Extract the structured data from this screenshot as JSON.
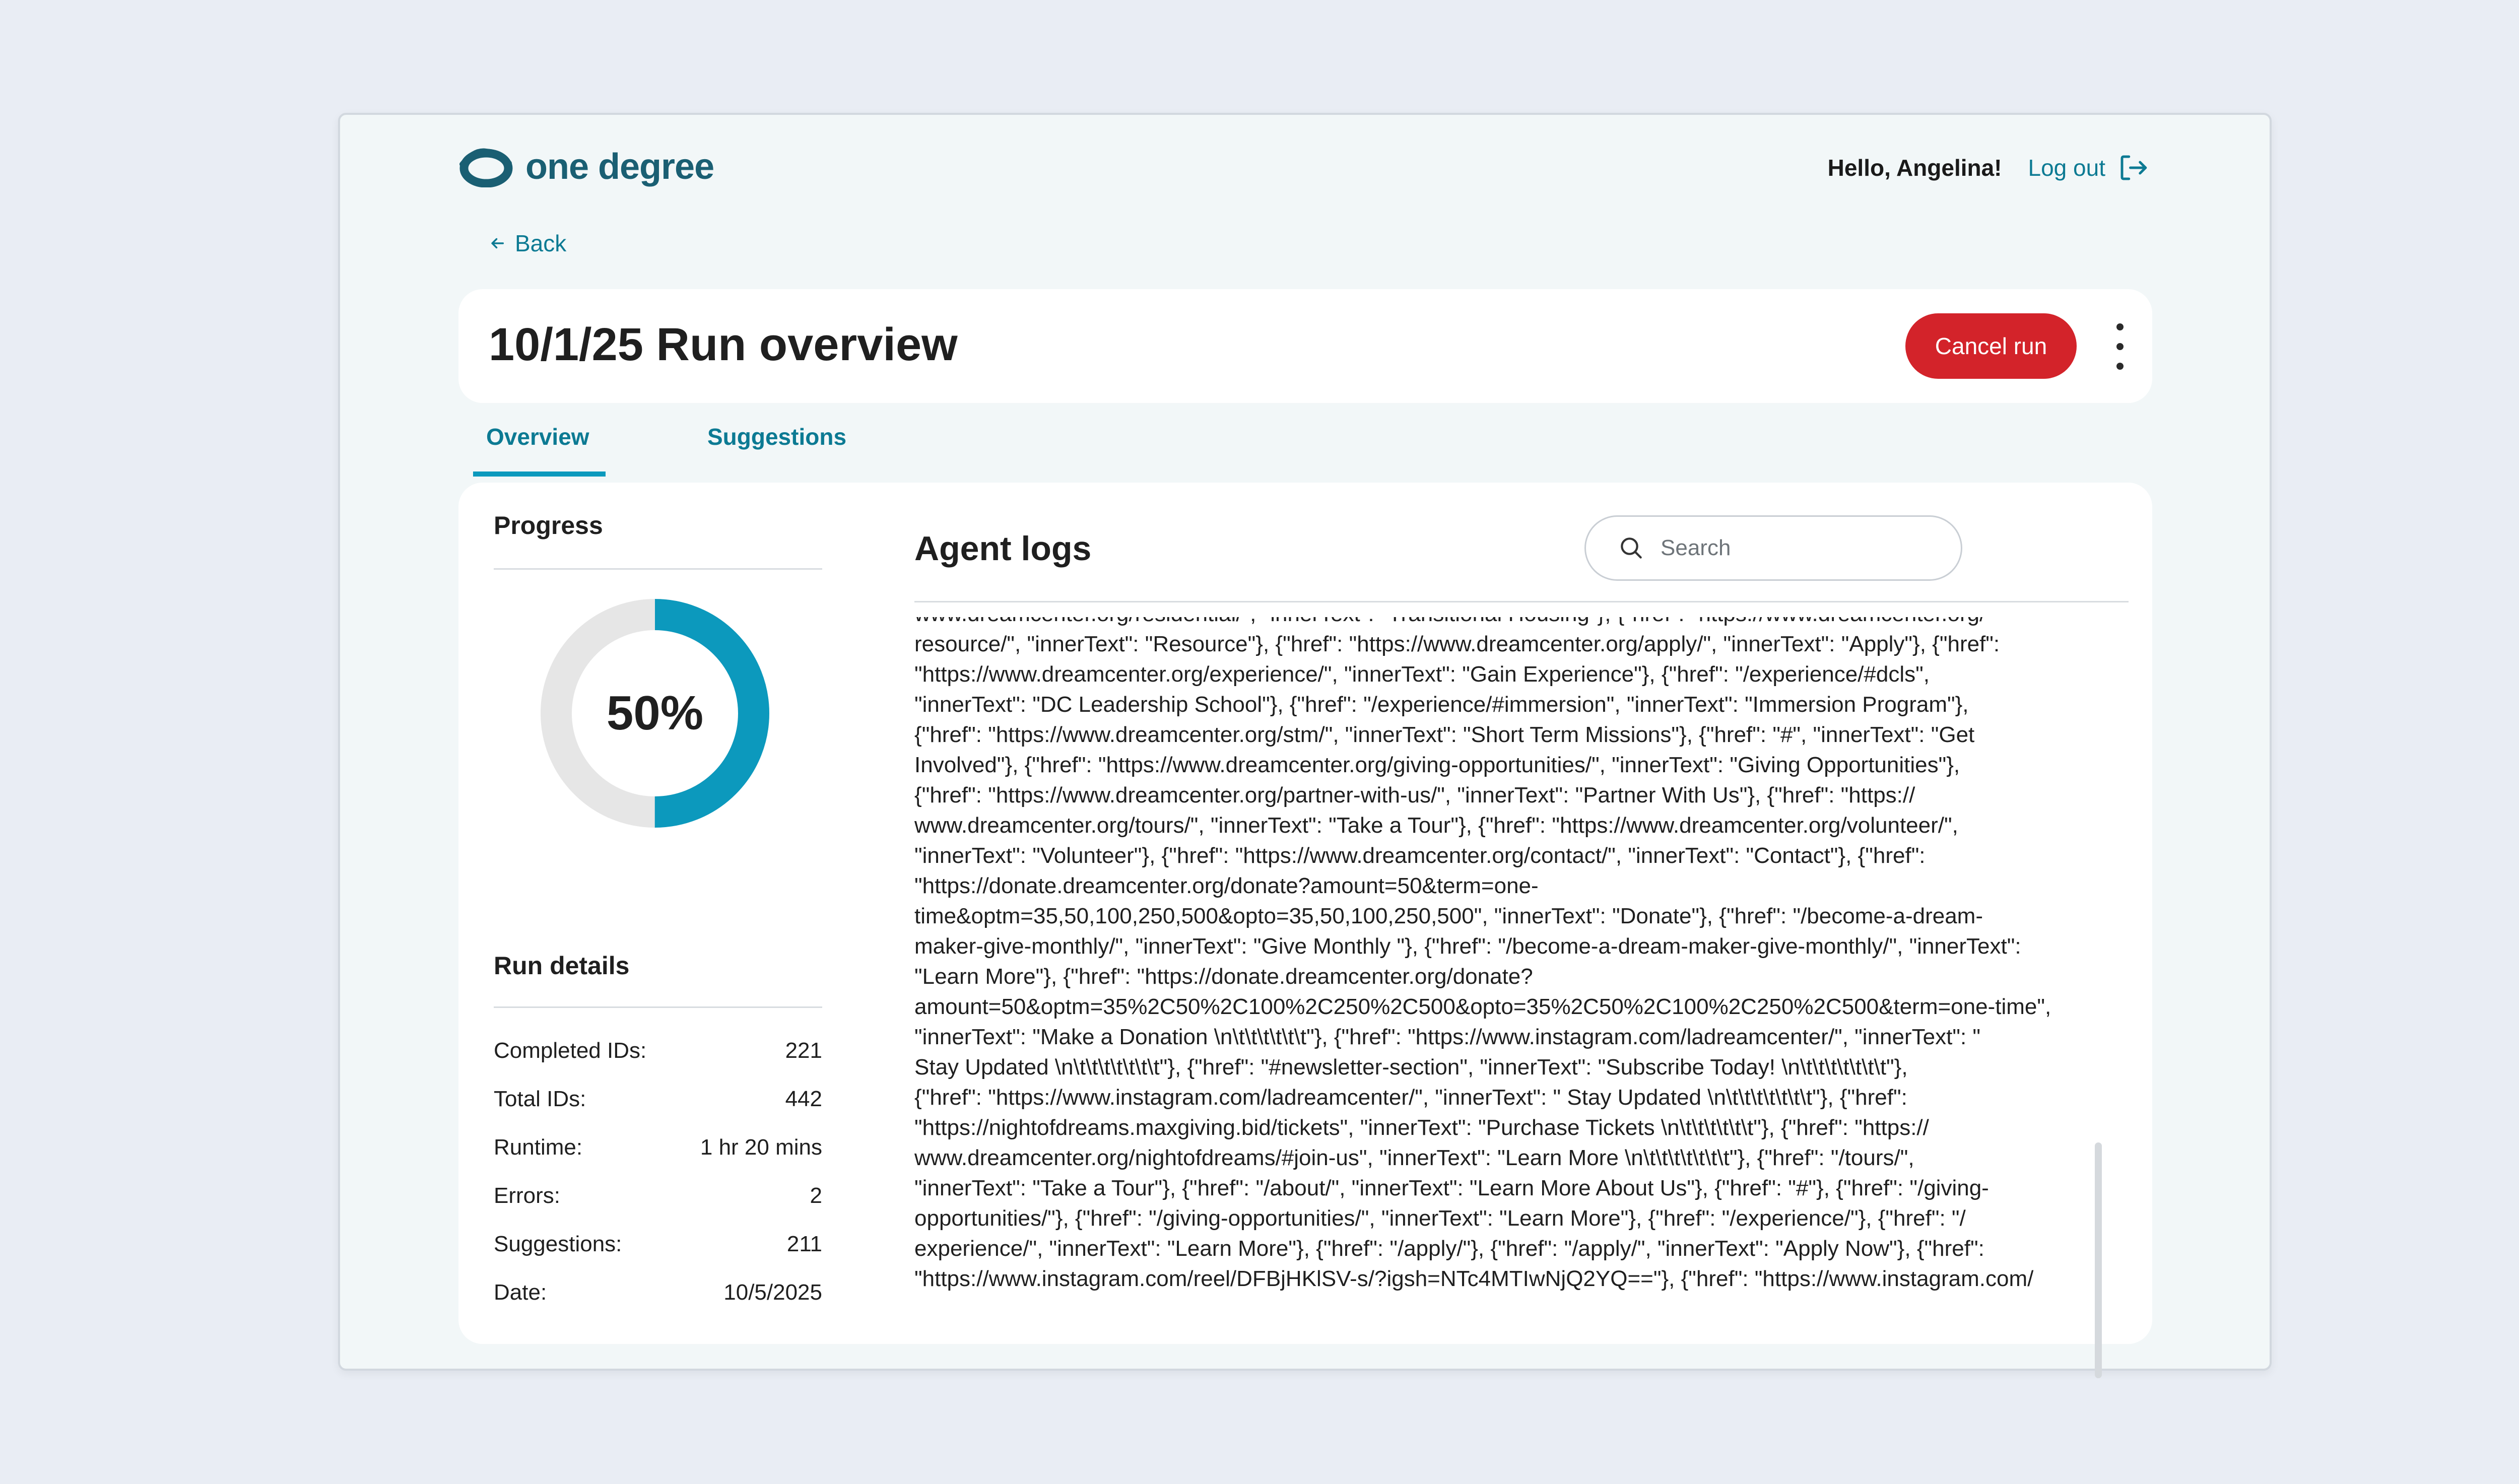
{
  "brand": {
    "name": "one degree",
    "logo_icon": "one-degree-logo-icon",
    "color": "#1a5f73"
  },
  "user": {
    "greeting": "Hello, Angelina!",
    "logout_label": "Log out"
  },
  "nav": {
    "back_label": "Back"
  },
  "header": {
    "title": "10/1/25 Run overview",
    "cancel_label": "Cancel run"
  },
  "tabs": [
    {
      "label": "Overview",
      "active": true
    },
    {
      "label": "Suggestions",
      "active": false
    }
  ],
  "progress": {
    "title": "Progress",
    "percent": 50,
    "percent_label": "50%",
    "track_color": "#e6e6e6",
    "fill_color": "#0c99bd"
  },
  "run_details": {
    "title": "Run details",
    "rows": [
      {
        "label": "Completed IDs:",
        "value": "221"
      },
      {
        "label": "Total IDs:",
        "value": "442"
      },
      {
        "label": "Runtime:",
        "value": "1 hr 20 mins"
      },
      {
        "label": "Errors:",
        "value": "2"
      },
      {
        "label": "Suggestions:",
        "value": "211"
      },
      {
        "label": "Date:",
        "value": "10/5/2025"
      }
    ]
  },
  "logs": {
    "title": "Agent logs",
    "search_placeholder": "Search",
    "lines": [
      "www.dreamcenter.org/residential/\", \"innerText\": \"Transitional Housing\"}, {\"href\": \"https://www.dreamcenter.org/",
      "resource/\", \"innerText\": \"Resource\"}, {\"href\": \"https://www.dreamcenter.org/apply/\", \"innerText\": \"Apply\"}, {\"href\":",
      "\"https://www.dreamcenter.org/experience/\", \"innerText\": \"Gain Experience\"}, {\"href\": \"/experience/#dcls\",",
      "\"innerText\": \"DC Leadership School\"}, {\"href\": \"/experience/#immersion\", \"innerText\": \"Immersion Program\"},",
      "{\"href\": \"https://www.dreamcenter.org/stm/\", \"innerText\": \"Short Term Missions\"}, {\"href\": \"#\", \"innerText\": \"Get",
      "Involved\"}, {\"href\": \"https://www.dreamcenter.org/giving-opportunities/\", \"innerText\": \"Giving Opportunities\"},",
      "{\"href\": \"https://www.dreamcenter.org/partner-with-us/\", \"innerText\": \"Partner With Us\"}, {\"href\": \"https://",
      "www.dreamcenter.org/tours/\", \"innerText\": \"Take a Tour\"}, {\"href\": \"https://www.dreamcenter.org/volunteer/\",",
      "\"innerText\": \"Volunteer\"}, {\"href\": \"https://www.dreamcenter.org/contact/\", \"innerText\": \"Contact\"}, {\"href\":",
      "\"https://donate.dreamcenter.org/donate?amount=50&term=one-",
      "time&optm=35,50,100,250,500&opto=35,50,100,250,500\", \"innerText\": \"Donate\"}, {\"href\": \"/become-a-dream-",
      "maker-give-monthly/\", \"innerText\": \"Give Monthly \"}, {\"href\": \"/become-a-dream-maker-give-monthly/\", \"innerText\":",
      "\"Learn More\"}, {\"href\": \"https://donate.dreamcenter.org/donate?",
      "amount=50&optm=35%2C50%2C100%2C250%2C500&opto=35%2C50%2C100%2C250%2C500&term=one-time\",",
      "\"innerText\": \"Make a Donation \\n\\t\\t\\t\\t\\t\\t\"}, {\"href\": \"https://www.instagram.com/ladreamcenter/\", \"innerText\": \"",
      "Stay Updated \\n\\t\\t\\t\\t\\t\\t\\t\"}, {\"href\": \"#newsletter-section\", \"innerText\": \"Subscribe Today! \\n\\t\\t\\t\\t\\t\\t\\t\"},",
      "{\"href\": \"https://www.instagram.com/ladreamcenter/\", \"innerText\": \" Stay Updated \\n\\t\\t\\t\\t\\t\\t\\t\"}, {\"href\":",
      "\"https://nightofdreams.maxgiving.bid/tickets\", \"innerText\": \"Purchase Tickets  \\n\\t\\t\\t\\t\\t\\t\"}, {\"href\": \"https://",
      "www.dreamcenter.org/nightofdreams/#join-us\", \"innerText\": \"Learn More \\n\\t\\t\\t\\t\\t\\t\\t\"}, {\"href\": \"/tours/\",",
      "\"innerText\": \"Take a Tour\"}, {\"href\": \"/about/\", \"innerText\": \"Learn More About Us\"}, {\"href\": \"#\"}, {\"href\": \"/giving-",
      "opportunities/\"}, {\"href\": \"/giving-opportunities/\", \"innerText\": \"Learn More\"}, {\"href\": \"/experience/\"}, {\"href\": \"/",
      "experience/\", \"innerText\": \"Learn More\"}, {\"href\": \"/apply/\"}, {\"href\": \"/apply/\", \"innerText\": \"Apply Now\"}, {\"href\":",
      "\"https://www.instagram.com/reel/DFBjHKlSV-s/?igsh=NTc4MTIwNjQ2YQ==\"}, {\"href\": \"https://www.instagram.com/"
    ]
  }
}
